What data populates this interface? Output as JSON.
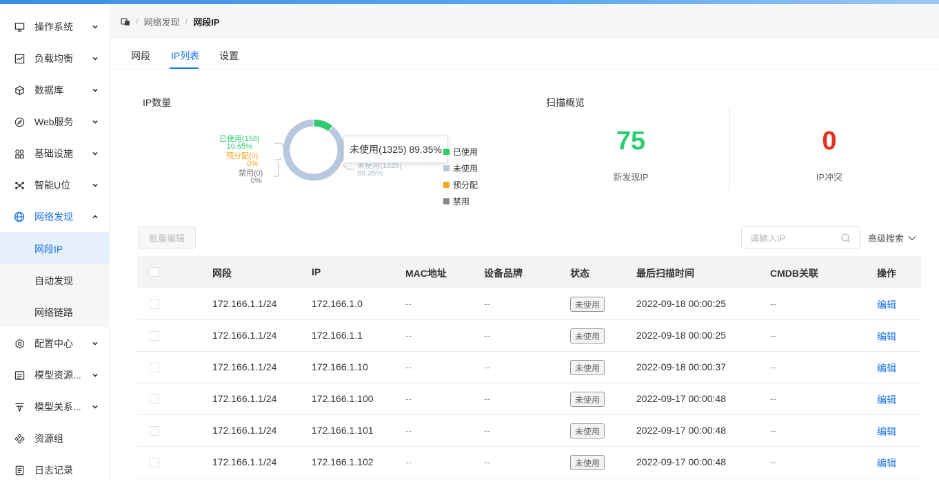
{
  "sidebar": {
    "items": [
      {
        "label": "操作系统",
        "icon": "monitor-icon",
        "expanded": false
      },
      {
        "label": "负载均衡",
        "icon": "line-chart-icon",
        "expanded": false
      },
      {
        "label": "数据库",
        "icon": "cube-icon",
        "expanded": false
      },
      {
        "label": "Web服务",
        "icon": "compass-icon",
        "expanded": false
      },
      {
        "label": "基础设施",
        "icon": "grid-icon",
        "expanded": false
      },
      {
        "label": "智能U位",
        "icon": "cluster-icon",
        "expanded": false
      },
      {
        "label": "网络发现",
        "icon": "globe-icon",
        "expanded": true
      },
      {
        "label": "配置中心",
        "icon": "settings-icon",
        "expanded": false
      },
      {
        "label": "模型资源...",
        "icon": "list-icon",
        "expanded": false
      },
      {
        "label": "模型关系...",
        "icon": "funnel-icon",
        "expanded": false
      },
      {
        "label": "资源组",
        "icon": "diamond-icon"
      },
      {
        "label": "日志记录",
        "icon": "log-icon"
      }
    ],
    "subitems": [
      {
        "label": "网段IP",
        "active": true
      },
      {
        "label": "自动发现",
        "active": false
      },
      {
        "label": "网络链路",
        "active": false
      }
    ]
  },
  "breadcrumb": {
    "items": [
      "网络发现",
      "网段IP"
    ]
  },
  "tabs": [
    {
      "label": "网段",
      "active": false
    },
    {
      "label": "IP列表",
      "active": true
    },
    {
      "label": "设置",
      "active": false
    }
  ],
  "ip_stats": {
    "title": "IP数量",
    "tooltip": "未使用(1325) 89.35%",
    "labels": {
      "used": "已使用(158)",
      "used_pct": "10.65%",
      "reserved": "预分配(0)",
      "reserved_pct": "0%",
      "disabled": "禁用(0)",
      "disabled_pct": "0%",
      "unused": "未使用(1325)",
      "unused_pct": "89.35%"
    },
    "legend": [
      "已使用",
      "未使用",
      "预分配",
      "禁用"
    ]
  },
  "chart_data": {
    "type": "pie",
    "categories": [
      "已使用",
      "未使用",
      "预分配",
      "禁用"
    ],
    "values": [
      158,
      1325,
      0,
      0
    ],
    "percentages": [
      10.65,
      89.35,
      0,
      0
    ],
    "colors": [
      "#2ecc71",
      "#b8c8de",
      "#f5a623",
      "#888888"
    ]
  },
  "scan_overview": {
    "title": "扫描概览",
    "new_ip_value": "75",
    "new_ip_label": "新发现IP",
    "conflict_value": "0",
    "conflict_label": "IP冲突"
  },
  "toolbar": {
    "batch_edit": "批量编辑",
    "search_placeholder": "请输入IP",
    "advanced_search": "高级搜索"
  },
  "table": {
    "headers": [
      "网段",
      "IP",
      "MAC地址",
      "设备品牌",
      "状态",
      "最后扫描时间",
      "CMDB关联",
      "操作"
    ],
    "rows": [
      {
        "segment": "172.166.1.1/24",
        "ip": "172.166.1.0",
        "mac": "--",
        "brand": "--",
        "status": "未使用",
        "scan_time": "2022-09-18 00:00:25",
        "cmdb": "--",
        "action": "编辑"
      },
      {
        "segment": "172.166.1.1/24",
        "ip": "172.166.1.1",
        "mac": "--",
        "brand": "--",
        "status": "未使用",
        "scan_time": "2022-09-18 00:00:25",
        "cmdb": "--",
        "action": "编辑"
      },
      {
        "segment": "172.166.1.1/24",
        "ip": "172.166.1.10",
        "mac": "--",
        "brand": "--",
        "status": "未使用",
        "scan_time": "2022-09-18 00:00:37",
        "cmdb": "--",
        "action": "编辑"
      },
      {
        "segment": "172.166.1.1/24",
        "ip": "172.166.1.100",
        "mac": "--",
        "brand": "--",
        "status": "未使用",
        "scan_time": "2022-09-17 00:00:48",
        "cmdb": "--",
        "action": "编辑"
      },
      {
        "segment": "172.166.1.1/24",
        "ip": "172.166.1.101",
        "mac": "--",
        "brand": "--",
        "status": "未使用",
        "scan_time": "2022-09-17 00:00:48",
        "cmdb": "--",
        "action": "编辑"
      },
      {
        "segment": "172.166.1.1/24",
        "ip": "172.166.1.102",
        "mac": "--",
        "brand": "--",
        "status": "未使用",
        "scan_time": "2022-09-17 00:00:48",
        "cmdb": "--",
        "action": "编辑"
      }
    ]
  },
  "colors": {
    "accent": "#1a73e8",
    "success": "#2ecc71",
    "danger": "#e8321f",
    "warning": "#f5a623"
  }
}
